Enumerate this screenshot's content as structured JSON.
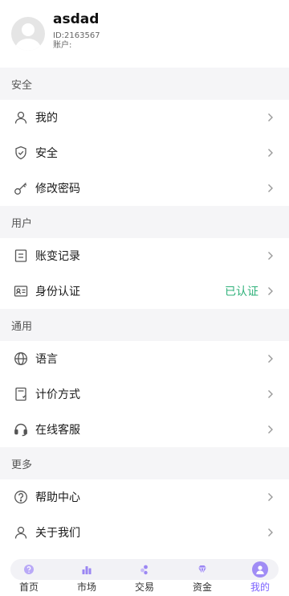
{
  "profile": {
    "username": "asdad",
    "uid": "ID:2163567",
    "account_label": "账户:"
  },
  "sections": [
    {
      "title": "安全",
      "items": [
        {
          "label": "我的",
          "icon": "user-icon"
        },
        {
          "label": "安全",
          "icon": "shield-icon"
        },
        {
          "label": "修改密码",
          "icon": "key-icon"
        }
      ]
    },
    {
      "title": "用户",
      "items": [
        {
          "label": "账变记录",
          "icon": "document-icon"
        },
        {
          "label": "身份认证",
          "icon": "id-card-icon",
          "status": "已认证"
        }
      ]
    },
    {
      "title": "通用",
      "items": [
        {
          "label": "语言",
          "icon": "globe-icon"
        },
        {
          "label": "计价方式",
          "icon": "calculator-icon"
        },
        {
          "label": "在线客服",
          "icon": "headset-icon"
        }
      ]
    },
    {
      "title": "更多",
      "items": [
        {
          "label": "帮助中心",
          "icon": "question-icon"
        },
        {
          "label": "关于我们",
          "icon": "user-icon"
        }
      ]
    }
  ],
  "tabbar": {
    "items": [
      {
        "label": "首页",
        "icon": "home-icon"
      },
      {
        "label": "市场",
        "icon": "bar-chart-icon"
      },
      {
        "label": "交易",
        "icon": "exchange-icon"
      },
      {
        "label": "资金",
        "icon": "diamond-icon"
      },
      {
        "label": "我的",
        "icon": "profile-icon",
        "active": true
      }
    ]
  },
  "colors": {
    "accent": "#7b61ff",
    "verified": "#2fb17a",
    "section_bg": "#f5f5f7"
  }
}
